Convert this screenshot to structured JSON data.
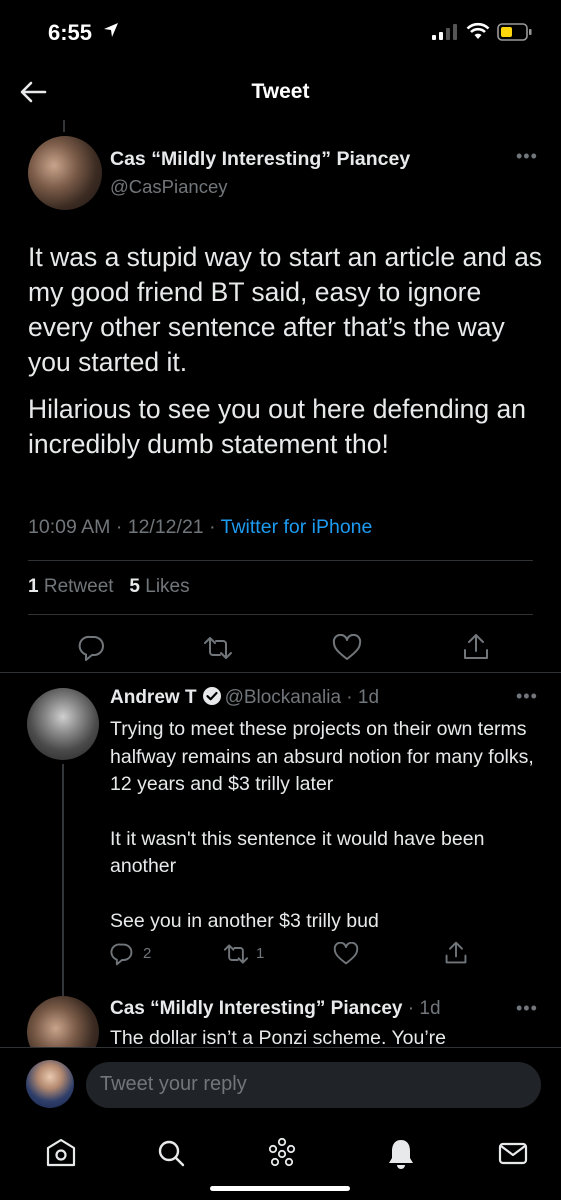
{
  "status_bar": {
    "time": "6:55"
  },
  "header": {
    "title": "Tweet"
  },
  "main_tweet": {
    "author_name": "Cas “Mildly Interesting” Piancey",
    "author_handle": "@CasPiancey",
    "paragraphs": [
      "It was a stupid way to start an article and as my good friend BT said, easy to ignore every other sentence after that’s the way you started it.",
      "Hilarious to see you out here defending an incredibly dumb statement tho!"
    ],
    "time": "10:09 AM",
    "date": "12/12/21",
    "separator": "·",
    "source": "Twitter for iPhone",
    "retweets_count": "1",
    "retweets_label": "Retweet",
    "likes_count": "5",
    "likes_label": "Likes"
  },
  "replies": [
    {
      "author_name": "Andrew T",
      "verified": true,
      "author_handle": "@Blockanalia",
      "age": "1d",
      "paragraphs": [
        "Trying to meet these projects on their own terms halfway remains an absurd notion for many folks, 12 years and $3 trilly later",
        "It it wasn't this sentence it would have been another",
        "See you in another $3 trilly bud"
      ],
      "reply_count": "2",
      "retweet_count": "1"
    },
    {
      "author_name": "Cas “Mildly Interesting” Piancey",
      "age": "1d",
      "text": "The dollar isn’t a Ponzi scheme. You’re"
    }
  ],
  "compose": {
    "placeholder": "Tweet your reply"
  },
  "colors": {
    "background": "#000000",
    "accent": "#1d9bf0",
    "secondary_text": "#71767b",
    "primary_text": "#e7e9ea"
  },
  "icons": {
    "tabbar": [
      "home-icon",
      "search-icon",
      "spaces-icon",
      "notifications-icon",
      "messages-icon"
    ],
    "actions": [
      "reply-icon",
      "retweet-icon",
      "like-icon",
      "share-icon"
    ]
  }
}
